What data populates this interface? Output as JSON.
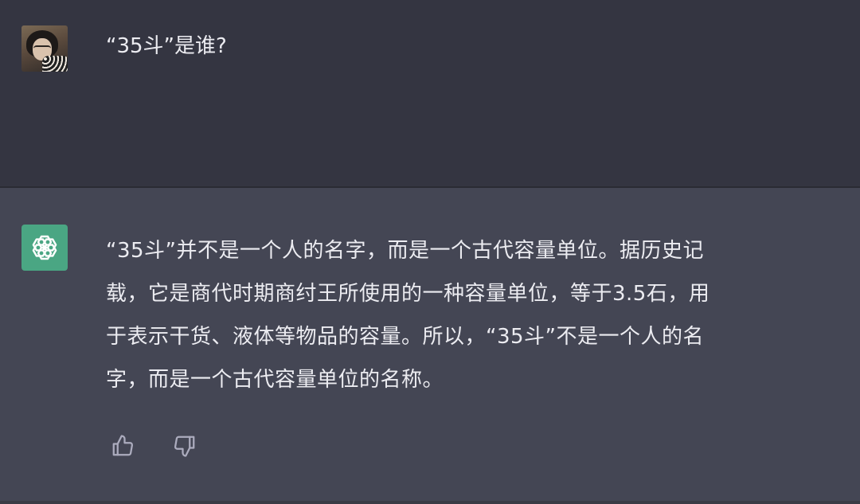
{
  "user_message": {
    "text": "“35斗”是谁?"
  },
  "assistant_message": {
    "lines": [
      "“35斗”并不是一个人的名字，而是一个古代容量单位。据历史记",
      "载，它是商代时期商纣王所使用的一种容量单位，等于3.5石，用",
      "于表示干货、液体等物品的容量。所以，“35斗”不是一个人的名",
      "字，而是一个古代容量单位的名称。"
    ]
  },
  "feedback": {
    "like_icon": "thumbs-up-icon",
    "dislike_icon": "thumbs-down-icon"
  },
  "colors": {
    "user_bg": "#343541",
    "assistant_bg": "#444654",
    "assistant_avatar_bg": "#4aa683",
    "text": "#ececf1",
    "icon": "#acacbe"
  }
}
